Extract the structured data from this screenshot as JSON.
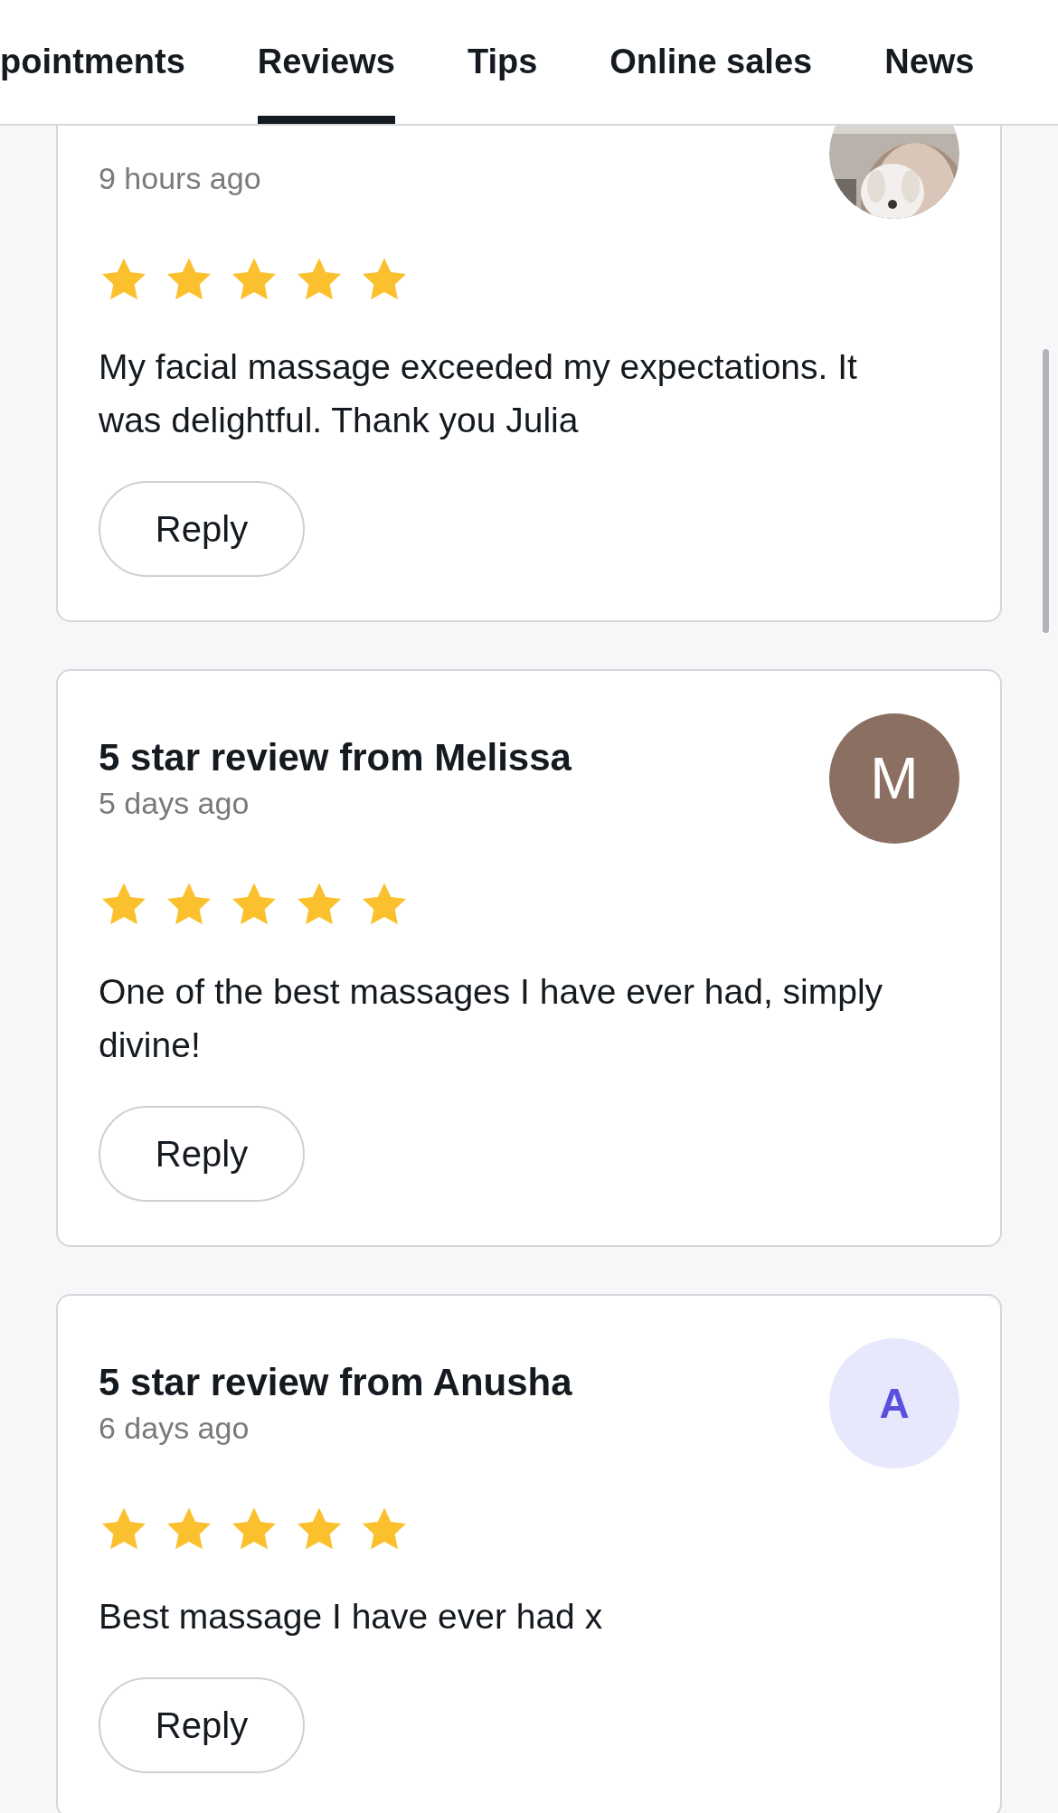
{
  "tabs": [
    {
      "label": "pointments",
      "selected": false
    },
    {
      "label": "Reviews",
      "selected": true
    },
    {
      "label": "Tips",
      "selected": false
    },
    {
      "label": "Online sales",
      "selected": false
    },
    {
      "label": "News",
      "selected": false
    }
  ],
  "reviews": [
    {
      "time": "9 hours ago",
      "stars": 5,
      "text": "My facial massage exceeded my expectations. It was delightful. Thank you Julia",
      "reply": "Reply"
    },
    {
      "title": "5 star review from Melissa",
      "time": "5 days ago",
      "stars": 5,
      "text": "One of the best massages I have ever had, simply divine!",
      "reply": "Reply",
      "avatar": {
        "kind": "initial-dark",
        "letter": "M",
        "color": "#8b6f63"
      }
    },
    {
      "title": "5 star review from Anusha",
      "time": "6 days ago",
      "stars": 5,
      "text": "Best massage I have ever had x",
      "reply": "Reply",
      "avatar": {
        "kind": "initial-light",
        "letter": "A",
        "color": "#e8e8fd"
      }
    }
  ]
}
